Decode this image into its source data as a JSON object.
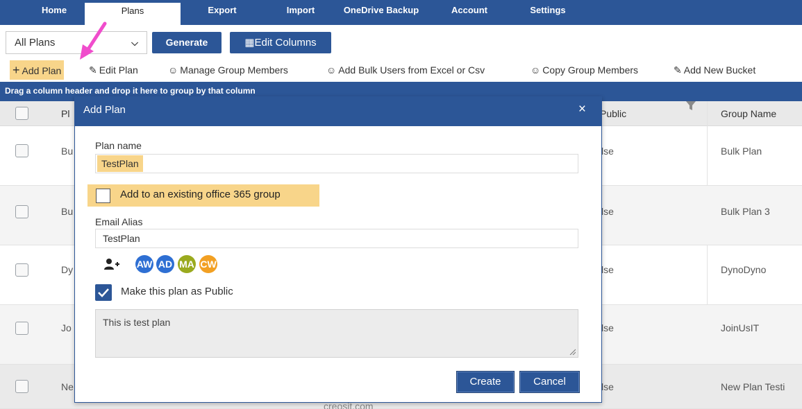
{
  "nav": {
    "tabs": [
      "Home",
      "Plans",
      "Export",
      "Import",
      "OneDrive Backup",
      "Account",
      "Settings"
    ],
    "active": "Plans"
  },
  "toolbar": {
    "filter_value": "All Plans",
    "generate_label": "Generate",
    "edit_columns_label": "Edit Columns",
    "add_plan_label": "Add Plan",
    "edit_plan_label": "Edit Plan",
    "manage_members_label": "Manage Group Members",
    "bulk_users_label": "Add Bulk Users from Excel or Csv",
    "copy_members_label": "Copy Group Members",
    "add_bucket_label": "Add New Bucket"
  },
  "grid": {
    "group_hint": "Drag a column header and drop it here to group by that column",
    "headers": {
      "plan": "Pl",
      "public": "Public",
      "group_name": "Group Name"
    },
    "rows": [
      {
        "plan": "Bu",
        "public": "lse",
        "group_name": "Bulk Plan"
      },
      {
        "plan": "Bu",
        "public": "lse",
        "group_name": "Bulk Plan 3"
      },
      {
        "plan": "Dy",
        "public": "lse",
        "group_name": "DynoDyno"
      },
      {
        "plan": "Jo",
        "public": "lse",
        "group_name": "JoinUsIT"
      },
      {
        "plan": "Ne",
        "public": "lse",
        "group_name": "New Plan Testi"
      }
    ],
    "partial_text": "creosit.com"
  },
  "modal": {
    "title": "Add Plan",
    "close": "×",
    "plan_name_label": "Plan name",
    "plan_name_value": "TestPlan",
    "existing_group_label": "Add to an existing office 365 group",
    "email_alias_label": "Email Alias",
    "email_alias_value": "TestPlan",
    "members": [
      {
        "initials": "AW",
        "color": "#2e6fd3"
      },
      {
        "initials": "AD",
        "color": "#2e6fd3"
      },
      {
        "initials": "MA",
        "color": "#9aaa1e"
      },
      {
        "initials": "CW",
        "color": "#f2a023"
      }
    ],
    "public_label": "Make this plan as Public",
    "description": "This is test plan",
    "create_label": "Create",
    "cancel_label": "Cancel"
  },
  "colors": {
    "primary": "#2c5697",
    "highlight": "#f8d58a",
    "arrow": "#f04dcc"
  }
}
